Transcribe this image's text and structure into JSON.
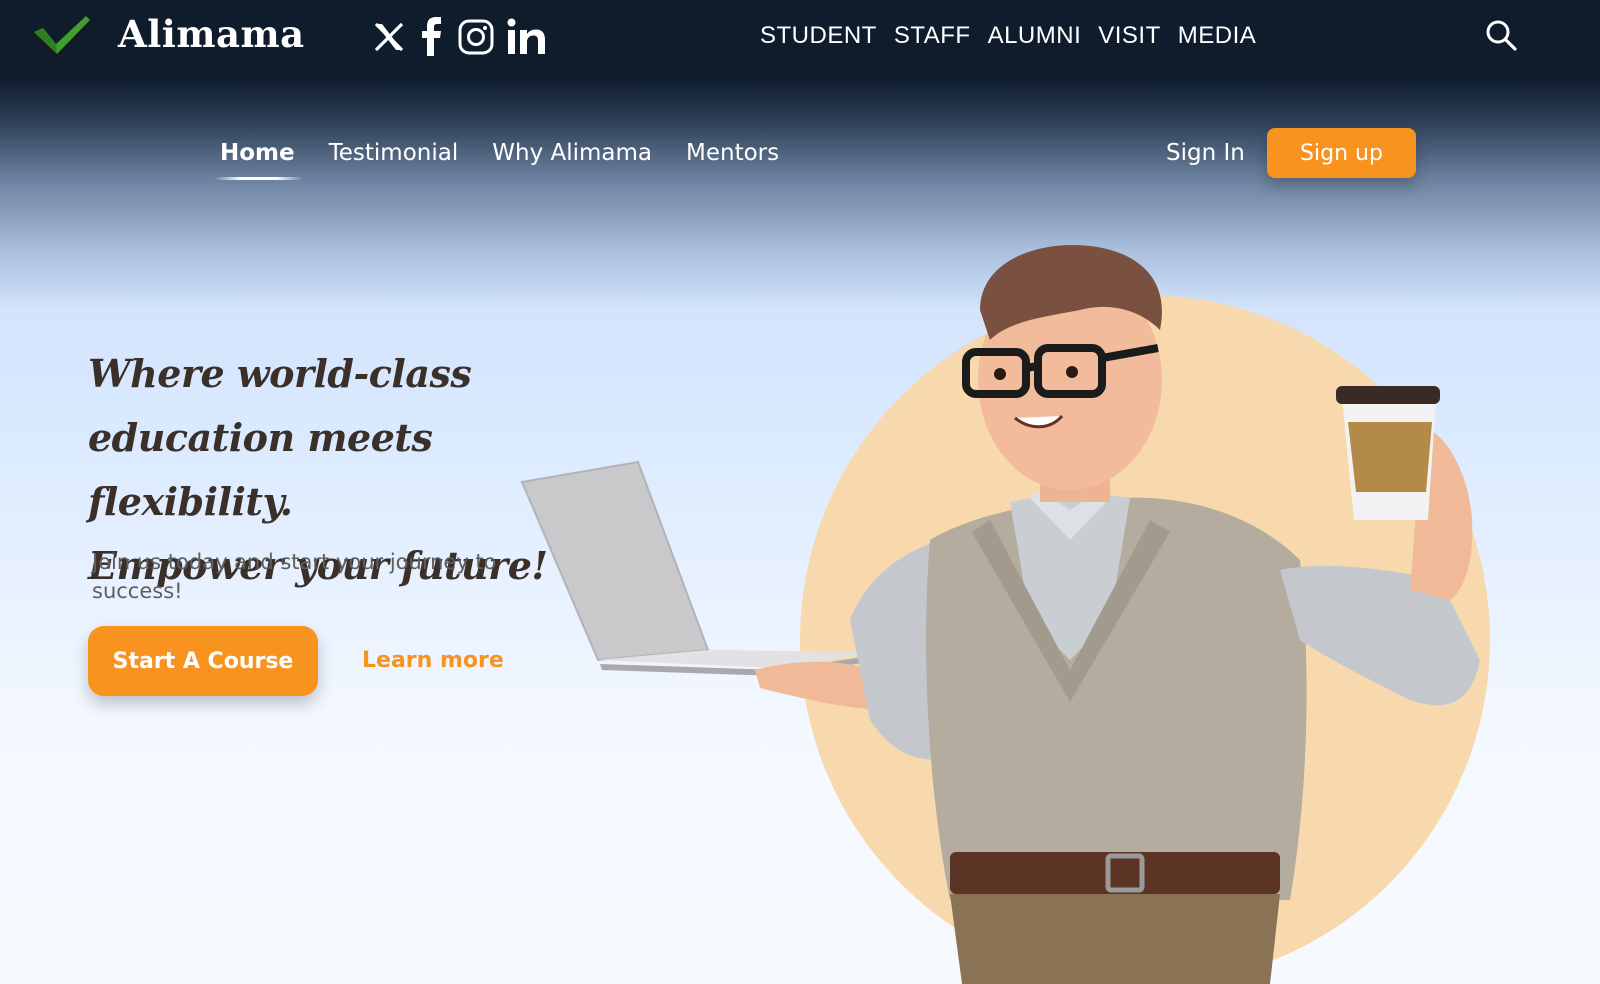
{
  "brand": {
    "name": "Alimama",
    "logo_icon": "checkmark-icon"
  },
  "social": [
    {
      "name": "x-icon"
    },
    {
      "name": "facebook-icon"
    },
    {
      "name": "instagram-icon"
    },
    {
      "name": "linkedin-icon"
    }
  ],
  "top_nav": [
    "STUDENT",
    "STAFF",
    "ALUMNI",
    "VISIT",
    "MEDIA"
  ],
  "search_icon": "search-icon",
  "main_nav": {
    "items": [
      "Home",
      "Testimonial",
      "Why Alimama",
      "Mentors"
    ],
    "active": "Home"
  },
  "auth": {
    "sign_in": "Sign In",
    "sign_up": "Sign up"
  },
  "hero": {
    "headline_lines": [
      "Where world-class",
      "education meets flexibility.",
      "Empower your future!"
    ],
    "subtext": "Join us today and start your journey to success!",
    "cta_label": "Start A Course",
    "learn_more": "Learn more"
  },
  "colors": {
    "accent": "#f7931e",
    "header_bg": "#0e1c2c",
    "headline": "#3b2f2a",
    "hero_circle": "#f8d9ad"
  }
}
